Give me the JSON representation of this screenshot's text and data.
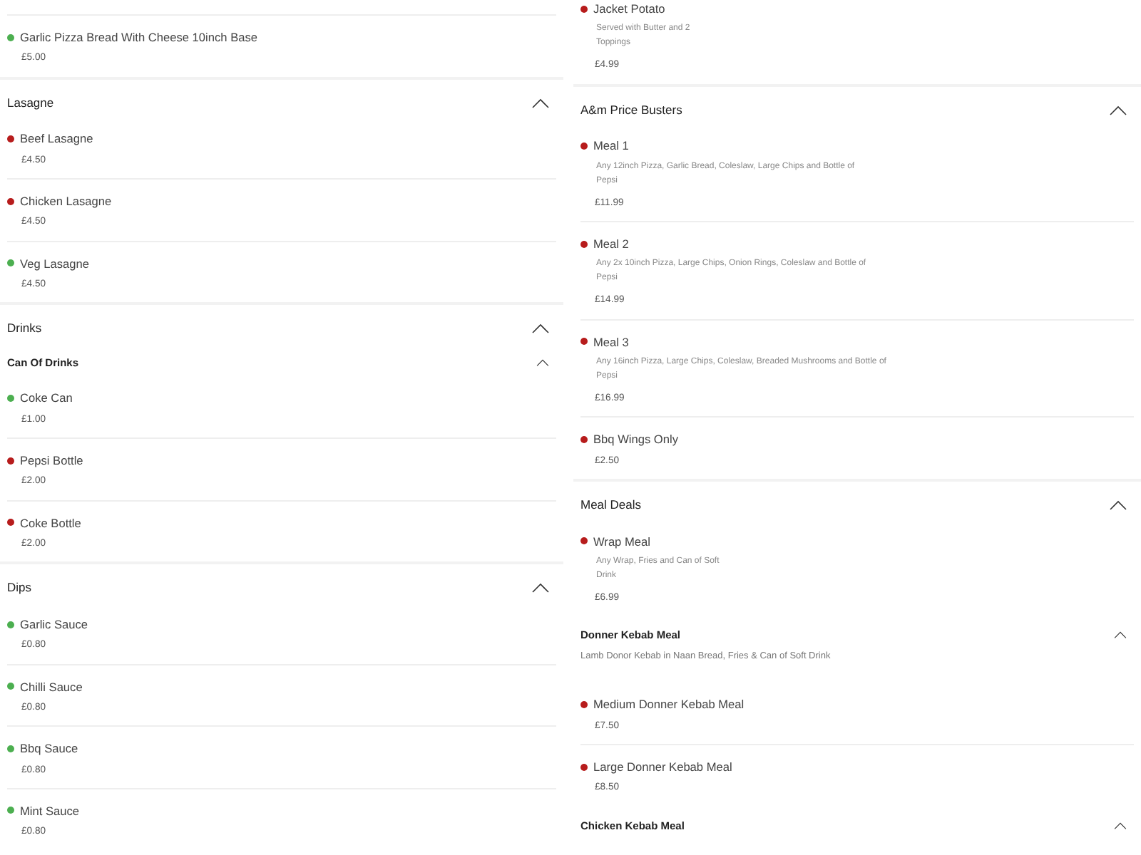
{
  "columns": [
    {
      "rows": [
        {
          "kind": "item",
          "name": "Garlic Pizza Bread With Cheese 10inch Base",
          "price": "£5.00",
          "color": "#4caf50"
        },
        {
          "kind": "section",
          "title": "Lasagne",
          "expanded": true
        },
        {
          "kind": "item",
          "name": "Beef Lasagne",
          "price": "£4.50",
          "color": "#b71c1c"
        },
        {
          "kind": "item",
          "name": "Chicken Lasagne",
          "price": "£4.50",
          "color": "#b71c1c"
        },
        {
          "kind": "item",
          "name": "Veg Lasagne",
          "price": "£4.50",
          "color": "#4caf50"
        },
        {
          "kind": "section",
          "title": "Drinks",
          "expanded": true
        },
        {
          "kind": "subsection",
          "title": "Can Of Drinks",
          "expanded": true
        },
        {
          "kind": "item",
          "name": "Coke Can",
          "price": "£1.00",
          "color": "#4caf50"
        },
        {
          "kind": "item",
          "name": "Pepsi Bottle",
          "price": "£2.00",
          "color": "#b71c1c"
        },
        {
          "kind": "item",
          "name": "Coke Bottle",
          "price": "£2.00",
          "color": "#b71c1c"
        },
        {
          "kind": "section",
          "title": "Dips",
          "expanded": true
        },
        {
          "kind": "item",
          "name": "Garlic Sauce",
          "price": "£0.80",
          "color": "#4caf50"
        },
        {
          "kind": "item",
          "name": "Chilli Sauce",
          "price": "£0.80",
          "color": "#4caf50"
        },
        {
          "kind": "item",
          "name": "Bbq Sauce",
          "price": "£0.80",
          "color": "#4caf50"
        },
        {
          "kind": "item",
          "name": "Mint Sauce",
          "price": "£0.80",
          "color": "#4caf50"
        }
      ]
    },
    {
      "rows": [
        {
          "kind": "item",
          "name": "Jacket Potato",
          "description_lines": [
            "Served with Butter and 2",
            "Toppings"
          ],
          "price": "£4.99",
          "color": "#b71c1c"
        },
        {
          "kind": "section",
          "title": "A&m Price Busters",
          "expanded": true
        },
        {
          "kind": "item",
          "name": "Meal 1",
          "description_lines": [
            "Any 12inch Pizza, Garlic Bread, Coleslaw, Large Chips and Bottle of",
            "Pepsi"
          ],
          "price": "£11.99",
          "color": "#b71c1c"
        },
        {
          "kind": "item",
          "name": "Meal 2",
          "description_lines": [
            "Any 2x 10inch Pizza, Large Chips, Onion Rings, Coleslaw and Bottle of",
            "Pepsi"
          ],
          "price": "£14.99",
          "color": "#b71c1c"
        },
        {
          "kind": "item",
          "name": "Meal 3",
          "description_lines": [
            "Any 16inch Pizza, Large Chips, Coleslaw, Breaded Mushrooms and Bottle of",
            "Pepsi"
          ],
          "price": "£16.99",
          "color": "#b71c1c"
        },
        {
          "kind": "item",
          "name": "Bbq Wings Only",
          "price": "£2.50",
          "color": "#b71c1c"
        },
        {
          "kind": "section",
          "title": "Meal Deals",
          "expanded": true
        },
        {
          "kind": "item",
          "name": "Wrap Meal",
          "description_lines": [
            "Any Wrap, Fries and Can of Soft",
            "Drink"
          ],
          "price": "£6.99",
          "color": "#b71c1c"
        },
        {
          "kind": "subsection",
          "title": "Donner Kebab Meal",
          "description": "Lamb Donor Kebab in Naan Bread, Fries & Can of Soft Drink",
          "expanded": true
        },
        {
          "kind": "item",
          "name": "Medium Donner Kebab Meal",
          "price": "£7.50",
          "color": "#b71c1c"
        },
        {
          "kind": "item",
          "name": "Large Donner Kebab Meal",
          "price": "£8.50",
          "color": "#b71c1c"
        },
        {
          "kind": "subsection",
          "title": "Chicken Kebab Meal",
          "expanded": true
        }
      ]
    }
  ]
}
